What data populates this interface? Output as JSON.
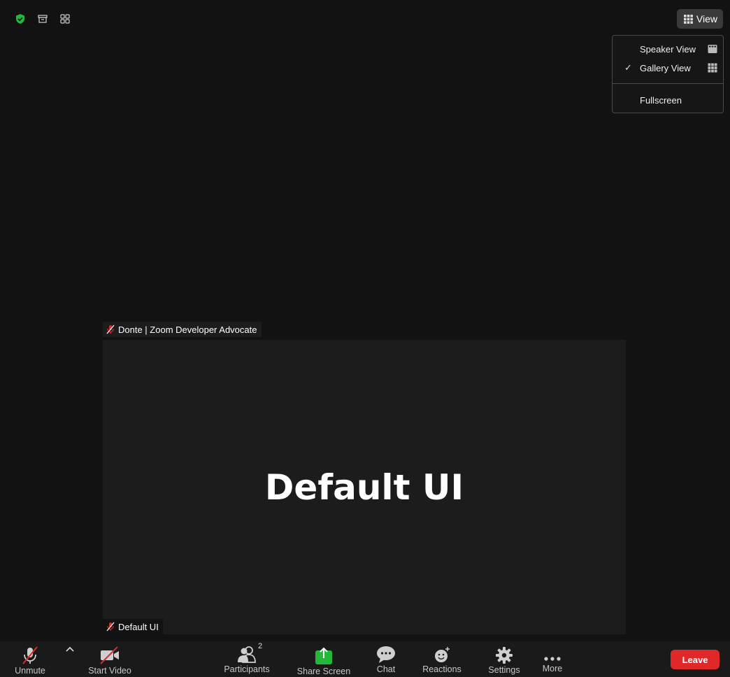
{
  "top": {
    "icons": [
      "shield-check-icon",
      "archive-icon",
      "grid-icon"
    ],
    "view_button_label": "View"
  },
  "view_menu": {
    "items": [
      {
        "label": "Speaker View",
        "checked": false,
        "icon": "speaker-view-icon"
      },
      {
        "label": "Gallery View",
        "checked": true,
        "icon": "gallery-view-icon"
      },
      {
        "label": "Fullscreen",
        "checked": false
      }
    ],
    "check_glyph": "✓"
  },
  "tile": {
    "top_label": "Donte | Zoom Developer Advocate",
    "main_text": "Default UI",
    "bottom_label": "Default UI"
  },
  "toolbar": {
    "unmute_label": "Unmute",
    "start_video_label": "Start Video",
    "participants_label": "Participants",
    "participants_count": "2",
    "share_screen_label": "Share Screen",
    "chat_label": "Chat",
    "reactions_label": "Reactions",
    "settings_label": "Settings",
    "more_label": "More",
    "leave_label": "Leave"
  },
  "colors": {
    "background": "#121212",
    "tile": "#1c1c1c",
    "toolbar": "#1a1a1a",
    "leave": "#e02828",
    "share_green": "#23b83a",
    "mute_red": "#e02828",
    "shield_green": "#23b83a"
  }
}
